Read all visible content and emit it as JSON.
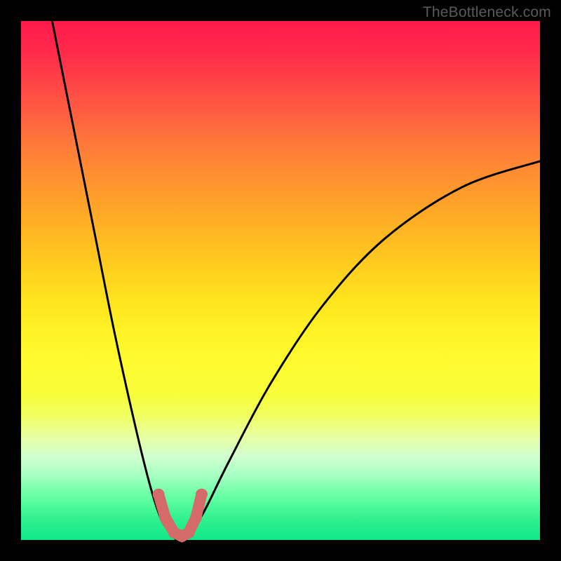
{
  "watermark": "TheBottleneck.com",
  "chart_data": {
    "type": "line",
    "title": "",
    "xlabel": "",
    "ylabel": "",
    "xlim": [
      0,
      100
    ],
    "ylim": [
      0,
      100
    ],
    "grid": false,
    "legend": false,
    "background": "rainbow-gradient-vertical",
    "series": [
      {
        "name": "left-curve",
        "x": [
          6,
          10,
          14,
          18,
          22,
          25,
          27,
          29,
          30
        ],
        "y": [
          100,
          80,
          60,
          40,
          22,
          10,
          4,
          1,
          0
        ]
      },
      {
        "name": "right-curve",
        "x": [
          30,
          32,
          35,
          40,
          48,
          58,
          70,
          85,
          100
        ],
        "y": [
          0,
          1,
          5,
          15,
          30,
          45,
          58,
          68,
          73
        ]
      }
    ],
    "annotations": [
      {
        "name": "trough-marker-dots",
        "shape": "path",
        "points_x": [
          26.5,
          27.8,
          29.5,
          31.0,
          32.3,
          33.7,
          34.8
        ],
        "points_y": [
          8.8,
          4.3,
          1.4,
          0.7,
          1.4,
          4.3,
          8.8
        ],
        "color": "#d46a6a"
      }
    ],
    "colors": {
      "curves": "#000000",
      "marker": "#d46a6a",
      "gradient_top": "#ff1a4d",
      "gradient_bottom": "#10e888"
    }
  }
}
